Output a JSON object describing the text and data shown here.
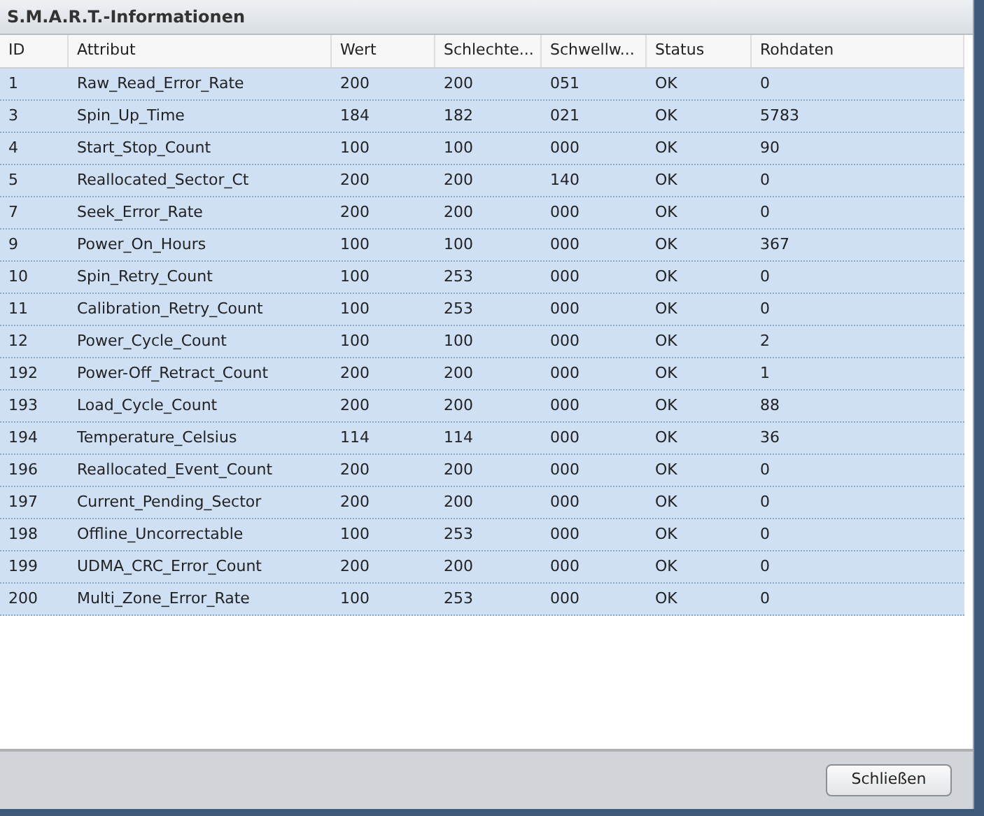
{
  "window": {
    "title": "S.M.A.R.T.-Informationen"
  },
  "table": {
    "columns": [
      "ID",
      "Attribut",
      "Wert",
      "Schlechte...",
      "Schwellw...",
      "Status",
      "Rohdaten"
    ],
    "rows": [
      {
        "cells": [
          "1",
          "Raw_Read_Error_Rate",
          "200",
          "200",
          "051",
          "OK",
          "0"
        ],
        "selected": true
      },
      {
        "cells": [
          "3",
          "Spin_Up_Time",
          "184",
          "182",
          "021",
          "OK",
          "5783"
        ],
        "selected": true
      },
      {
        "cells": [
          "4",
          "Start_Stop_Count",
          "100",
          "100",
          "000",
          "OK",
          "90"
        ],
        "selected": true
      },
      {
        "cells": [
          "5",
          "Reallocated_Sector_Ct",
          "200",
          "200",
          "140",
          "OK",
          "0"
        ],
        "selected": true
      },
      {
        "cells": [
          "7",
          "Seek_Error_Rate",
          "200",
          "200",
          "000",
          "OK",
          "0"
        ],
        "selected": true
      },
      {
        "cells": [
          "9",
          "Power_On_Hours",
          "100",
          "100",
          "000",
          "OK",
          "367"
        ],
        "selected": true
      },
      {
        "cells": [
          "10",
          "Spin_Retry_Count",
          "100",
          "253",
          "000",
          "OK",
          "0"
        ],
        "selected": true
      },
      {
        "cells": [
          "11",
          "Calibration_Retry_Count",
          "100",
          "253",
          "000",
          "OK",
          "0"
        ],
        "selected": true
      },
      {
        "cells": [
          "12",
          "Power_Cycle_Count",
          "100",
          "100",
          "000",
          "OK",
          "2"
        ],
        "selected": true
      },
      {
        "cells": [
          "192",
          "Power-Off_Retract_Count",
          "200",
          "200",
          "000",
          "OK",
          "1"
        ],
        "selected": true
      },
      {
        "cells": [
          "193",
          "Load_Cycle_Count",
          "200",
          "200",
          "000",
          "OK",
          "88"
        ],
        "selected": true
      },
      {
        "cells": [
          "194",
          "Temperature_Celsius",
          "114",
          "114",
          "000",
          "OK",
          "36"
        ],
        "selected": true
      },
      {
        "cells": [
          "196",
          "Reallocated_Event_Count",
          "200",
          "200",
          "000",
          "OK",
          "0"
        ],
        "selected": true
      },
      {
        "cells": [
          "197",
          "Current_Pending_Sector",
          "200",
          "200",
          "000",
          "OK",
          "0"
        ],
        "selected": true
      },
      {
        "cells": [
          "198",
          "Offline_Uncorrectable",
          "100",
          "253",
          "000",
          "OK",
          "0"
        ],
        "selected": true
      },
      {
        "cells": [
          "199",
          "UDMA_CRC_Error_Count",
          "200",
          "200",
          "000",
          "OK",
          "0"
        ],
        "selected": true
      },
      {
        "cells": [
          "200",
          "Multi_Zone_Error_Rate",
          "100",
          "253",
          "000",
          "OK",
          "0"
        ],
        "selected": true
      }
    ]
  },
  "buttons": [
    "Schließen"
  ]
}
